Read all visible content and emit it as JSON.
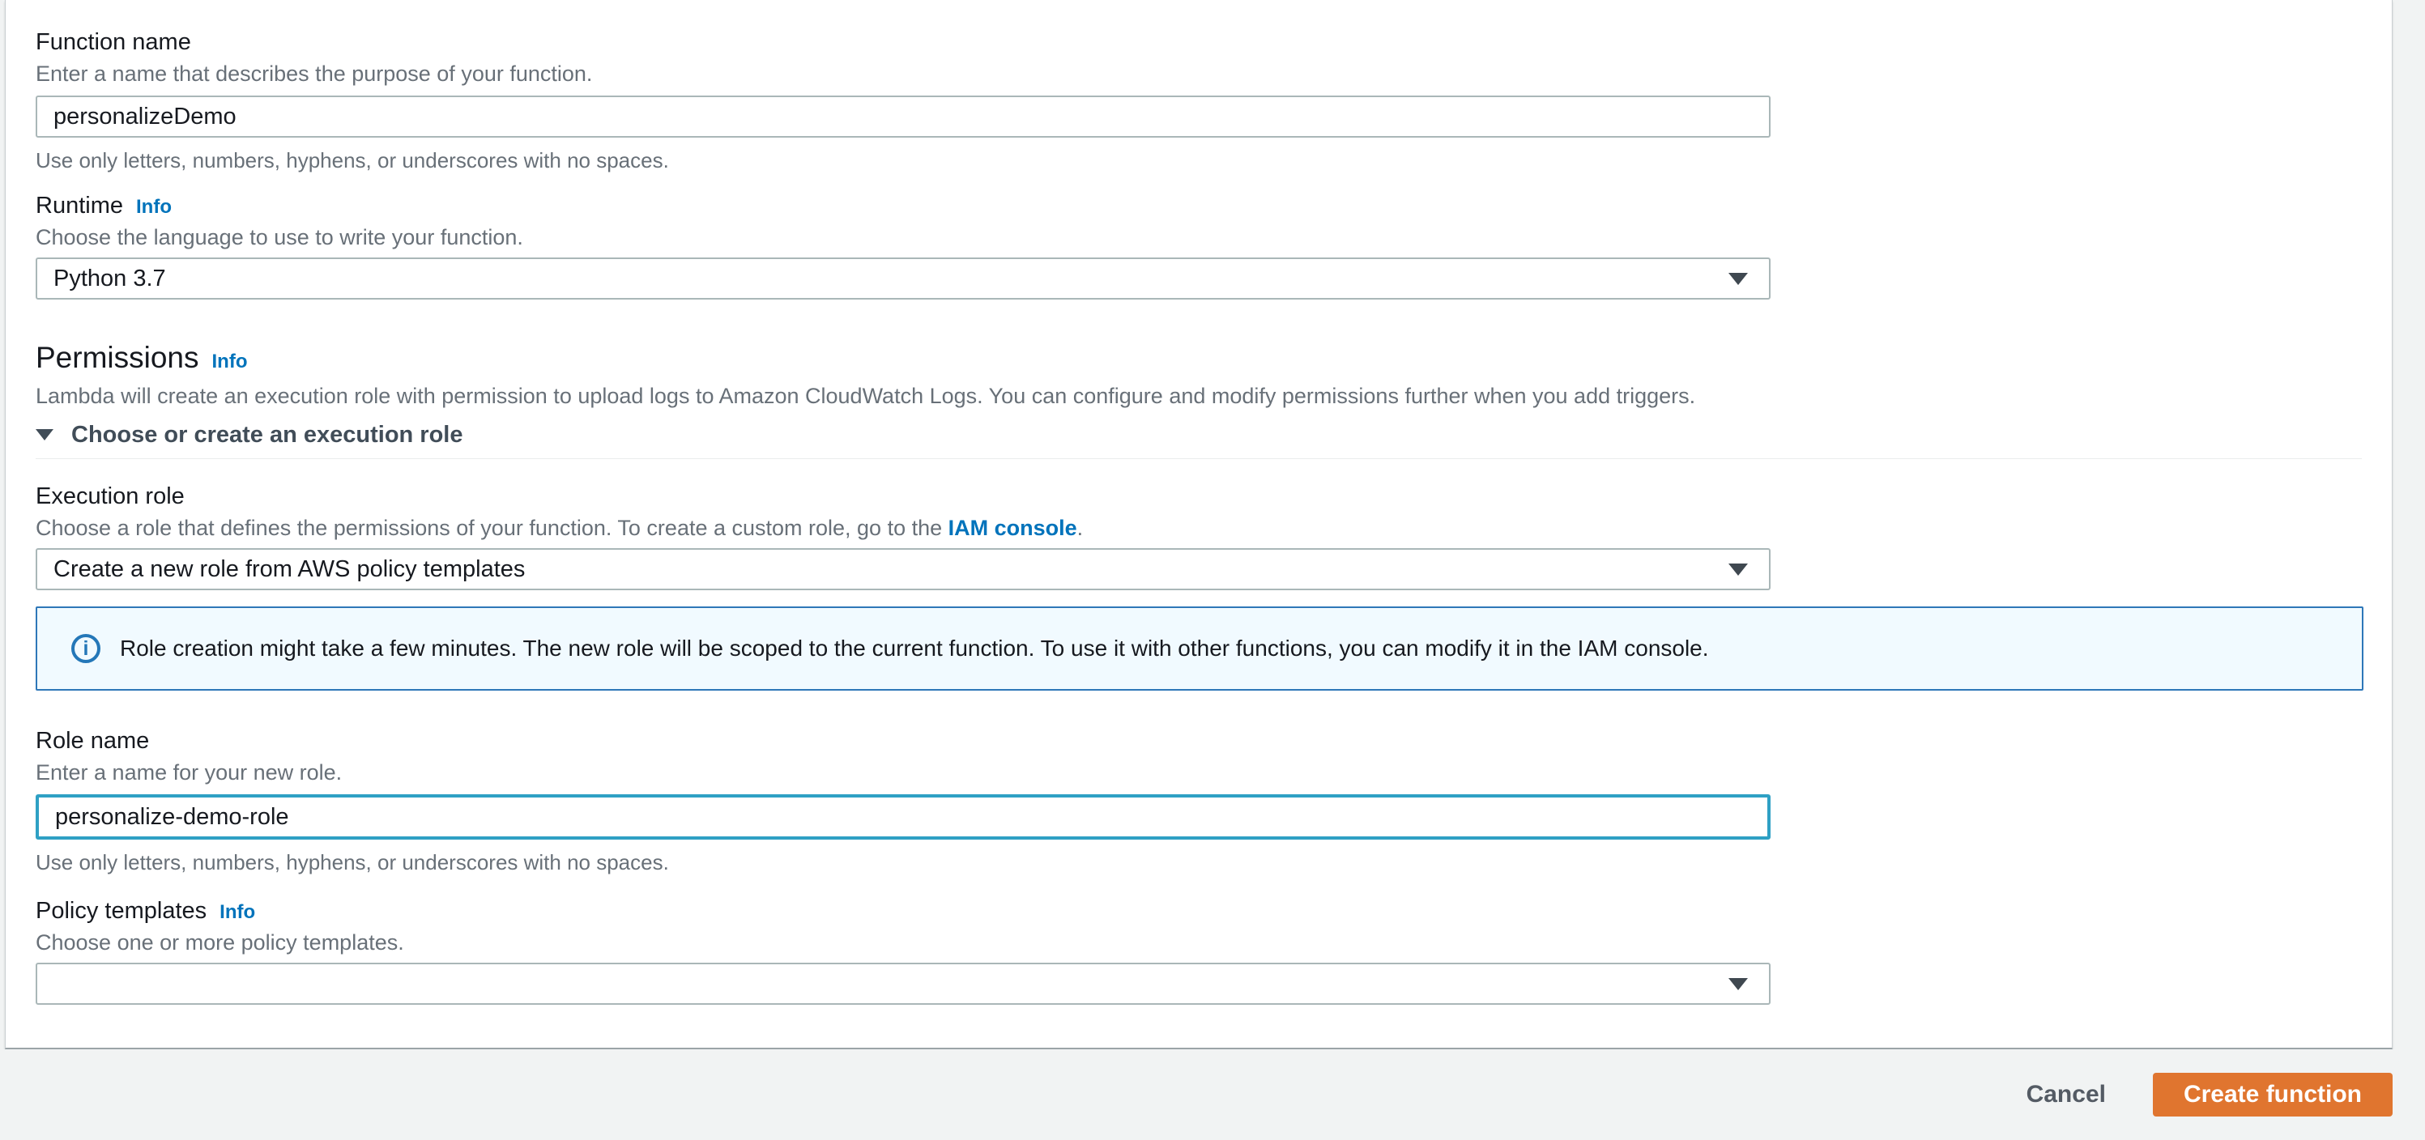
{
  "colors": {
    "page_background": "#f1f3f3",
    "panel_background": "#ffffff",
    "link_blue": "#0073bb",
    "alert_border": "#2e77b8",
    "alert_background": "#f1faff",
    "focus_border": "#2ea0c4",
    "primary_button": "#e0752f"
  },
  "icons": {
    "dropdown": "chevron-down-triangle",
    "expander": "triangle-down",
    "alert_info_glyph": "i"
  },
  "form": {
    "function_name": {
      "label": "Function name",
      "description": "Enter a name that describes the purpose of your function.",
      "value": "personalizeDemo",
      "constraint": "Use only letters, numbers, hyphens, or underscores with no spaces."
    },
    "runtime": {
      "label": "Runtime",
      "info_label": "Info",
      "description": "Choose the language to use to write your function.",
      "selected": "Python 3.7"
    },
    "permissions": {
      "heading": "Permissions",
      "info_label": "Info",
      "description": "Lambda will create an execution role with permission to upload logs to Amazon CloudWatch Logs. You can configure and modify permissions further when you add triggers.",
      "expander_label": "Choose or create an execution role"
    },
    "execution_role": {
      "label": "Execution role",
      "description_prefix": "Choose a role that defines the permissions of your function. To create a custom role, go to the ",
      "link_text": "IAM console",
      "description_suffix": ".",
      "selected": "Create a new role from AWS policy templates"
    },
    "role_alert": {
      "text": "Role creation might take a few minutes. The new role will be scoped to the current function. To use it with other functions, you can modify it in the IAM console."
    },
    "role_name": {
      "label": "Role name",
      "description": "Enter a name for your new role.",
      "value": "personalize-demo-role",
      "constraint": "Use only letters, numbers, hyphens, or underscores with no spaces."
    },
    "policy_templates": {
      "label": "Policy templates",
      "info_label": "Info",
      "description": "Choose one or more policy templates.",
      "selected": ""
    }
  },
  "footer": {
    "cancel_label": "Cancel",
    "create_label": "Create function"
  }
}
